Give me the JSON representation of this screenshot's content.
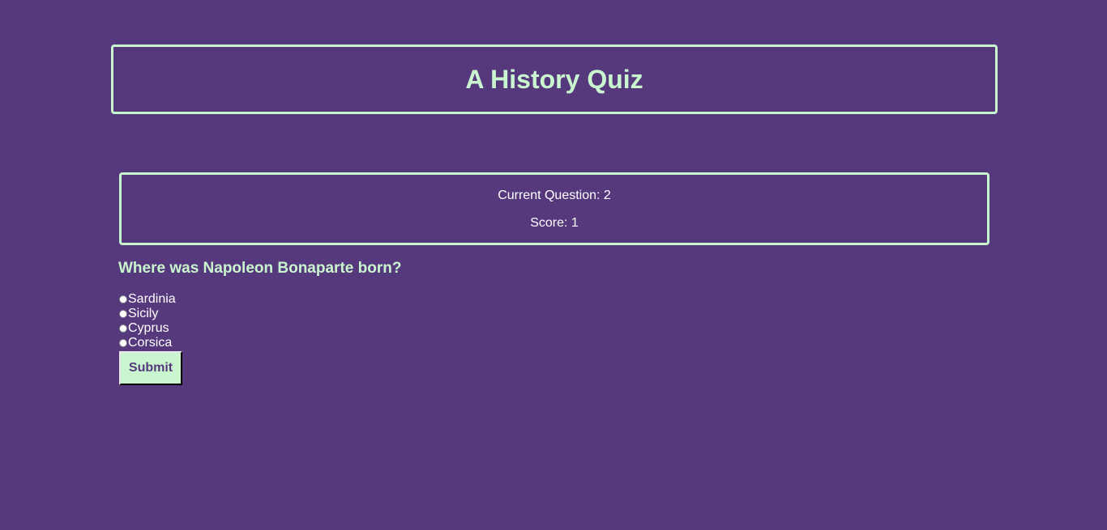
{
  "header": {
    "title": "A History Quiz"
  },
  "status": {
    "current_question_text": "Current Question: 2",
    "score_text": "Score: 1"
  },
  "quiz": {
    "question": "Where was Napoleon Bonaparte born?",
    "options": [
      {
        "label": "Sardinia",
        "selected": false
      },
      {
        "label": "Sicily",
        "selected": false
      },
      {
        "label": "Cyprus",
        "selected": false
      },
      {
        "label": "Corsica",
        "selected": false
      }
    ],
    "submit_label": "Submit"
  },
  "colors": {
    "background": "#56387d",
    "accent": "#c9f5cf",
    "text": "#ffffff"
  }
}
